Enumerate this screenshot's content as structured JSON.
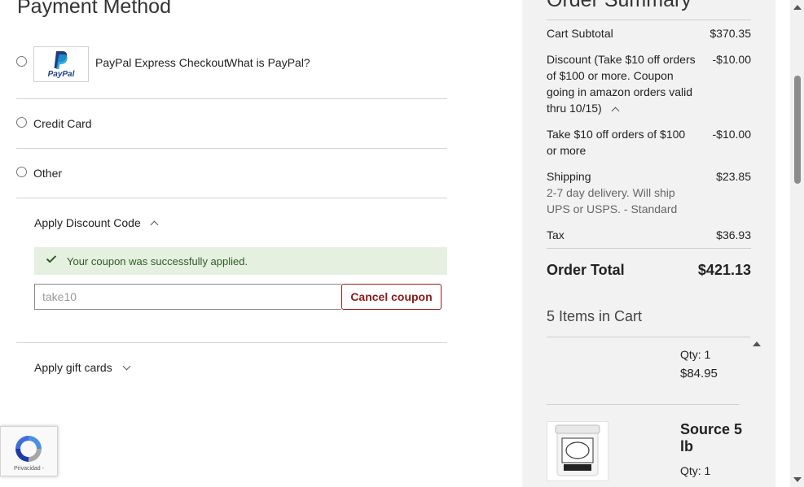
{
  "payment": {
    "title": "Payment Method",
    "options": [
      {
        "label": "PayPal Express Checkout",
        "link": "What is PayPal?",
        "logo_text": "PayPal"
      },
      {
        "label": "Credit Card"
      },
      {
        "label": "Other"
      }
    ]
  },
  "discount": {
    "title": "Apply Discount Code",
    "success_message": "Your coupon was successfully applied.",
    "code_value": "take10",
    "cancel_label": "Cancel coupon"
  },
  "gift": {
    "title": "Apply gift cards"
  },
  "recaptcha": {
    "text": "Privacidad -"
  },
  "summary": {
    "title": "Order Summary",
    "rows": [
      {
        "label": "Cart Subtotal",
        "value": "$370.35"
      },
      {
        "label": "Discount (Take $10 off orders of $100 or more. Coupon going in amazon orders valid thru 10/15)",
        "value": "-$10.00"
      },
      {
        "label": "Take $10 off orders of $100 or more",
        "value": "-$10.00"
      },
      {
        "label": "Shipping",
        "sub": "2-7 day delivery. Will ship UPS or USPS. - Standard",
        "value": "$23.85"
      },
      {
        "label": "Tax",
        "value": "$36.93"
      }
    ],
    "order_total_label": "Order Total",
    "order_total_value": "$421.13",
    "items_count": "5 Items in Cart"
  },
  "cart": {
    "items": [
      {
        "qty": "Qty: 1",
        "price": "$84.95"
      },
      {
        "name": "Source 5 lb",
        "qty": "Qty: 1"
      }
    ]
  },
  "colors": {
    "accent": "#8b1a1a",
    "success_bg": "#e5f0e1",
    "success_text": "#2e5b22",
    "panel_bg": "#f2f2f2",
    "paypal_blue": "#1d3f8e"
  }
}
